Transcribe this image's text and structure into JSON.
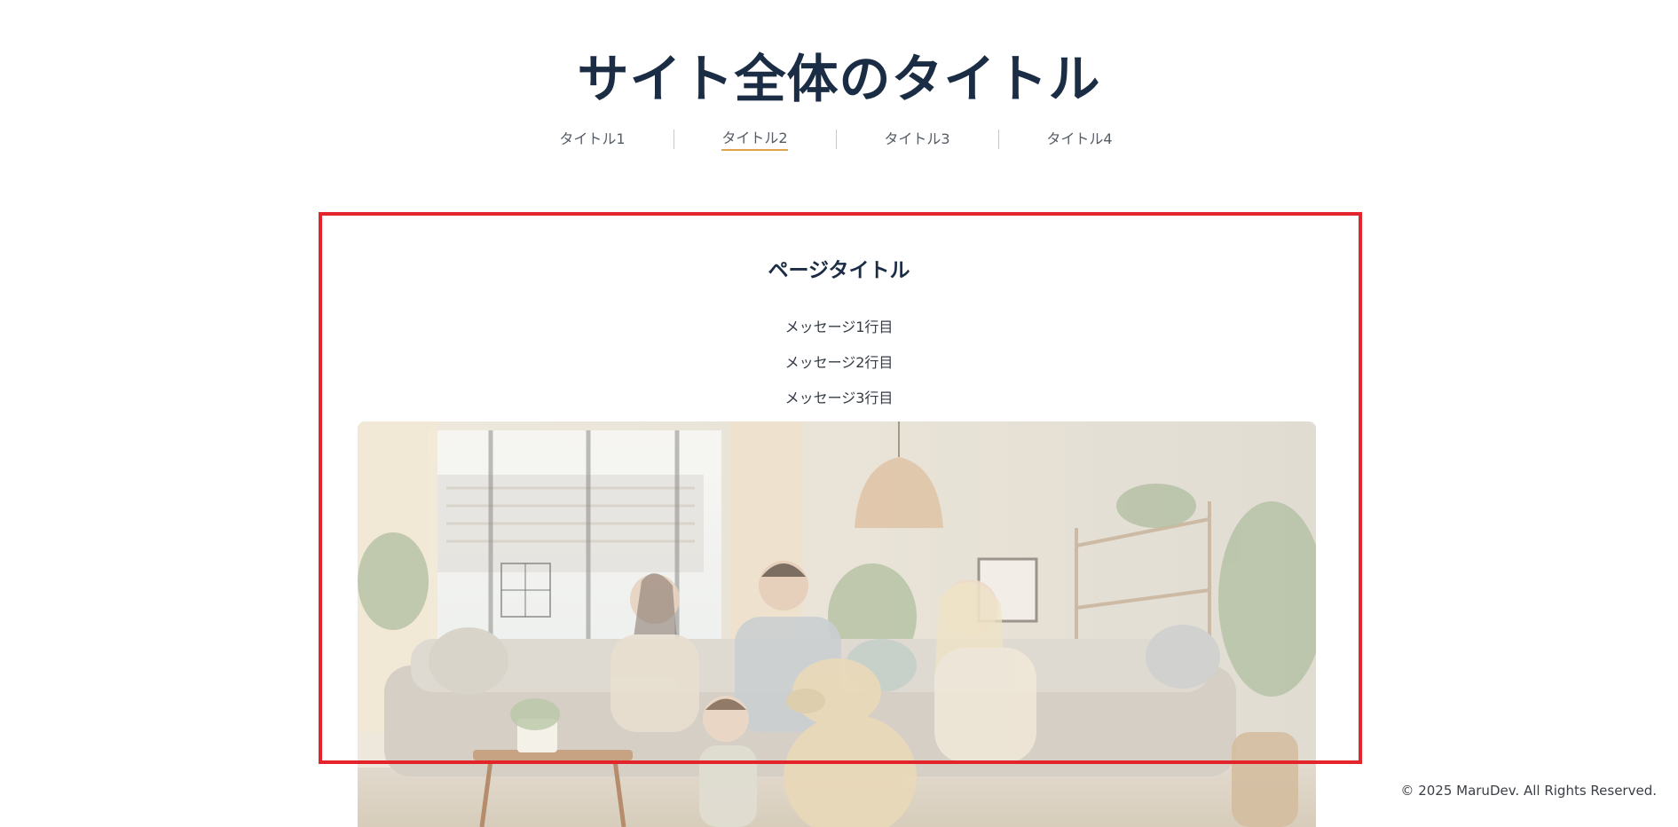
{
  "site": {
    "title": "サイト全体のタイトル"
  },
  "nav": {
    "items": [
      {
        "label": "タイトル1",
        "active": false
      },
      {
        "label": "タイトル2",
        "active": true
      },
      {
        "label": "タイトル3",
        "active": false
      },
      {
        "label": "タイトル4",
        "active": false
      }
    ],
    "active_underline_color": "#e0a24a"
  },
  "content": {
    "page_title": "ページタイトル",
    "messages": [
      "メッセージ1行目",
      "メッセージ2行目",
      "メッセージ3行目"
    ]
  },
  "hero_image": {
    "icon": "family-living-room-photo"
  },
  "highlight_color": "#e3242b",
  "footer": {
    "copyright": "© 2025 MaruDev. All Rights Reserved."
  }
}
